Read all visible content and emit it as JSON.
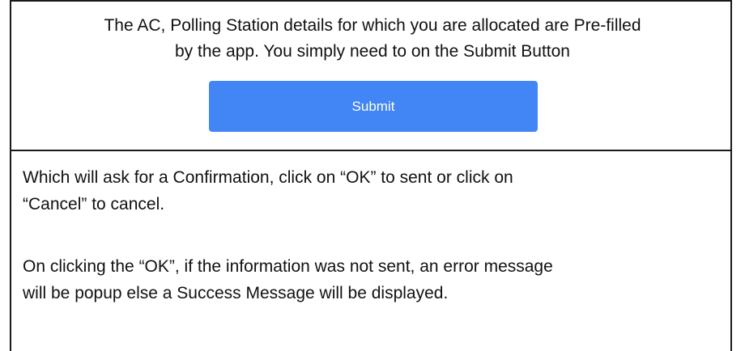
{
  "intro": {
    "line1": "The AC, Polling Station details for which you are allocated are Pre-filled",
    "line2": "by the app. You simply need to on the Submit Button"
  },
  "submit": {
    "label": "Submit",
    "color": "#4285f4"
  },
  "paragraphs": [
    {
      "line1": "Which will ask for a Confirmation, click on “OK” to sent or click on",
      "line2": "“Cancel” to cancel."
    },
    {
      "line1": "On clicking the “OK”, if the information was not sent, an error message",
      "line2": "will be popup else a Success Message will be displayed."
    }
  ]
}
